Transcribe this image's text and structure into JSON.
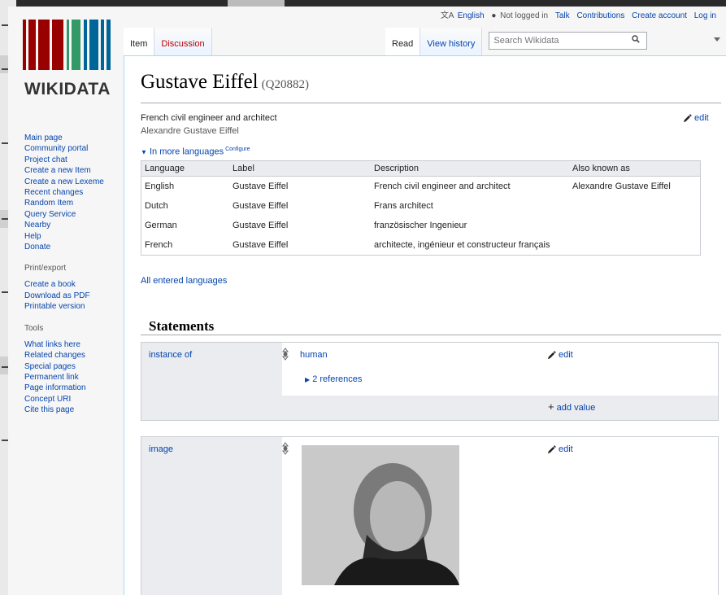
{
  "colors": {
    "link": "#0645ad",
    "redlink": "#ba0000",
    "logo_red": "#990000",
    "logo_green": "#339966",
    "logo_blue": "#006699"
  },
  "logo": {
    "text": "WIKIDATA"
  },
  "personal": {
    "lang_icon": "language-icon",
    "language": "English",
    "user_icon": "user-icon",
    "not_logged_in": "Not logged in",
    "talk": "Talk",
    "contributions": "Contributions",
    "create_account": "Create account",
    "log_in": "Log in"
  },
  "tabs": {
    "item": "Item",
    "discussion": "Discussion",
    "read": "Read",
    "view_history": "View history"
  },
  "search": {
    "placeholder": "Search Wikidata",
    "icon": "search-icon"
  },
  "sidebar": {
    "nav": [
      "Main page",
      "Community portal",
      "Project chat",
      "Create a new Item",
      "Create a new Lexeme",
      "Recent changes",
      "Random Item",
      "Query Service",
      "Nearby",
      "Help",
      "Donate"
    ],
    "print_heading": "Print/export",
    "print": [
      "Create a book",
      "Download as PDF",
      "Printable version"
    ],
    "tools_heading": "Tools",
    "tools": [
      "What links here",
      "Related changes",
      "Special pages",
      "Permanent link",
      "Page information",
      "Concept URI",
      "Cite this page"
    ]
  },
  "item": {
    "label": "Gustave Eiffel",
    "qid": "(Q20882)",
    "description": "French civil engineer and architect",
    "aliases": "Alexandre Gustave Eiffel",
    "edit": "edit"
  },
  "languages": {
    "toggle": "In more languages",
    "configure": "Configure",
    "headers": [
      "Language",
      "Label",
      "Description",
      "Also known as"
    ],
    "rows": [
      [
        "English",
        "Gustave Eiffel",
        "French civil engineer and architect",
        "Alexandre Gustave Eiffel"
      ],
      [
        "Dutch",
        "Gustave Eiffel",
        "Frans architect",
        ""
      ],
      [
        "German",
        "Gustave Eiffel",
        "französischer Ingenieur",
        ""
      ],
      [
        "French",
        "Gustave Eiffel",
        "architecte, ingénieur et constructeur français",
        ""
      ]
    ],
    "all_entered": "All entered languages"
  },
  "statements": {
    "heading": "Statements",
    "groups": [
      {
        "property": "instance of",
        "value": "human",
        "references": "2 references",
        "edit": "edit",
        "add_value": "add value"
      },
      {
        "property": "image",
        "edit": "edit"
      }
    ]
  }
}
